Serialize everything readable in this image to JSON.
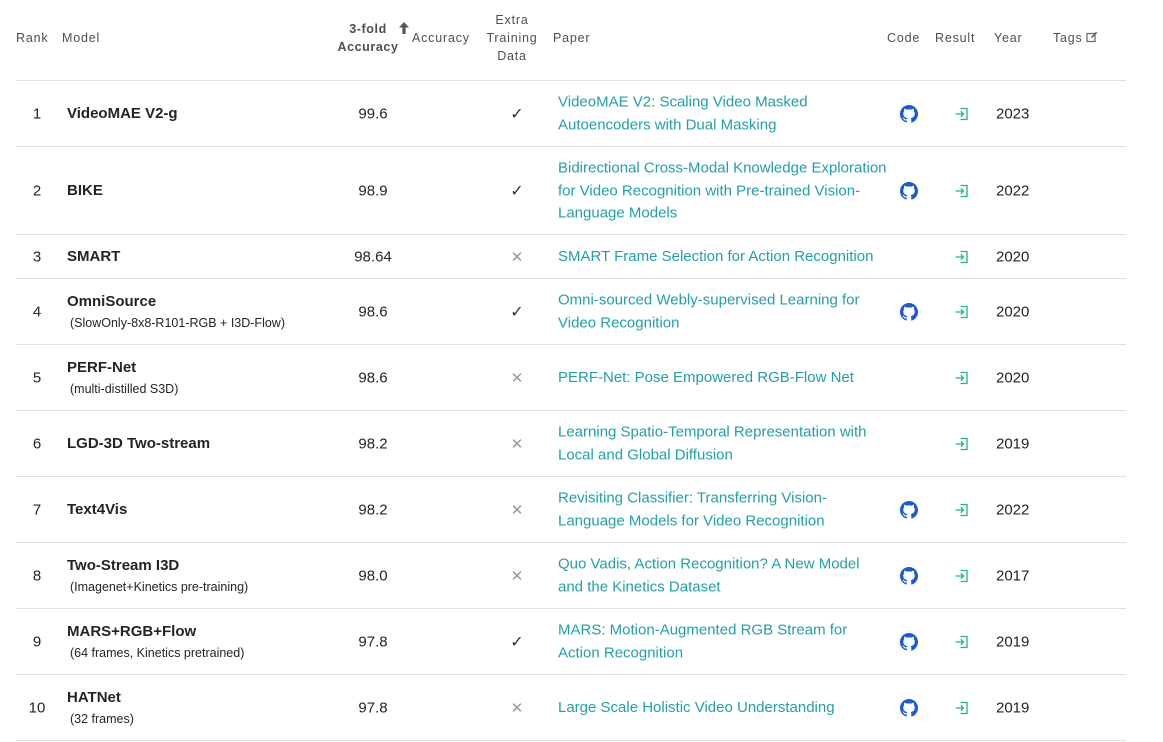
{
  "header": {
    "rank": "Rank",
    "model": "Model",
    "metric_sorted_line1": "3-fold",
    "metric_sorted_line2": "Accuracy",
    "accuracy": "Accuracy",
    "extra_line1": "Extra",
    "extra_line2": "Training",
    "extra_line3": "Data",
    "paper": "Paper",
    "code": "Code",
    "result": "Result",
    "year": "Year",
    "tags": "Tags"
  },
  "icons": {
    "sort": "arrow-up-icon",
    "tags_edit": "edit-icon",
    "code": "github-icon",
    "result": "sign-in-icon",
    "yes": "check-icon",
    "no": "cross-icon"
  },
  "colors": {
    "link": "#21a0a8",
    "github": "#1a5bd1",
    "result_icon": "#21b38a",
    "border": "#dee2e6"
  },
  "rows": [
    {
      "rank": "1",
      "model": "VideoMAE V2-g",
      "model_sub": "",
      "accuracy": "99.6",
      "extra": "✓",
      "paper": "VideoMAE V2: Scaling Video Masked Autoencoders with Dual Masking",
      "has_code": true,
      "year": "2023"
    },
    {
      "rank": "2",
      "model": "BIKE",
      "model_sub": "",
      "accuracy": "98.9",
      "extra": "✓",
      "paper": "Bidirectional Cross-Modal Knowledge Exploration for Video Recognition with Pre-trained Vision-Language Models",
      "has_code": true,
      "year": "2022"
    },
    {
      "rank": "3",
      "model": "SMART",
      "model_sub": "",
      "accuracy": "98.64",
      "extra": "✕",
      "paper": "SMART Frame Selection for Action Recognition",
      "has_code": false,
      "year": "2020"
    },
    {
      "rank": "4",
      "model": "OmniSource",
      "model_sub": "(SlowOnly-8x8-R101-RGB + I3D-Flow)",
      "accuracy": "98.6",
      "extra": "✓",
      "paper": "Omni-sourced Webly-supervised Learning for Video Recognition",
      "has_code": true,
      "year": "2020"
    },
    {
      "rank": "5",
      "model": "PERF-Net",
      "model_sub": "(multi-distilled S3D)",
      "accuracy": "98.6",
      "extra": "✕",
      "paper": "PERF-Net: Pose Empowered RGB-Flow Net",
      "has_code": false,
      "year": "2020"
    },
    {
      "rank": "6",
      "model": "LGD-3D Two-stream",
      "model_sub": "",
      "accuracy": "98.2",
      "extra": "✕",
      "paper": "Learning Spatio-Temporal Representation with Local and Global Diffusion",
      "has_code": false,
      "year": "2019"
    },
    {
      "rank": "7",
      "model": "Text4Vis",
      "model_sub": "",
      "accuracy": "98.2",
      "extra": "✕",
      "paper": "Revisiting Classifier: Transferring Vision-Language Models for Video Recognition",
      "has_code": true,
      "year": "2022"
    },
    {
      "rank": "8",
      "model": "Two-Stream I3D",
      "model_sub": "(Imagenet+Kinetics pre-training)",
      "accuracy": "98.0",
      "extra": "✕",
      "paper": "Quo Vadis, Action Recognition? A New Model and the Kinetics Dataset",
      "has_code": true,
      "year": "2017"
    },
    {
      "rank": "9",
      "model": "MARS+RGB+Flow",
      "model_sub": "(64 frames, Kinetics pretrained)",
      "accuracy": "97.8",
      "extra": "✓",
      "paper": "MARS: Motion-Augmented RGB Stream for Action Recognition",
      "has_code": true,
      "year": "2019"
    },
    {
      "rank": "10",
      "model": "HATNet",
      "model_sub": "(32 frames)",
      "accuracy": "97.8",
      "extra": "✕",
      "paper": "Large Scale Holistic Video Understanding",
      "has_code": true,
      "year": "2019"
    }
  ]
}
